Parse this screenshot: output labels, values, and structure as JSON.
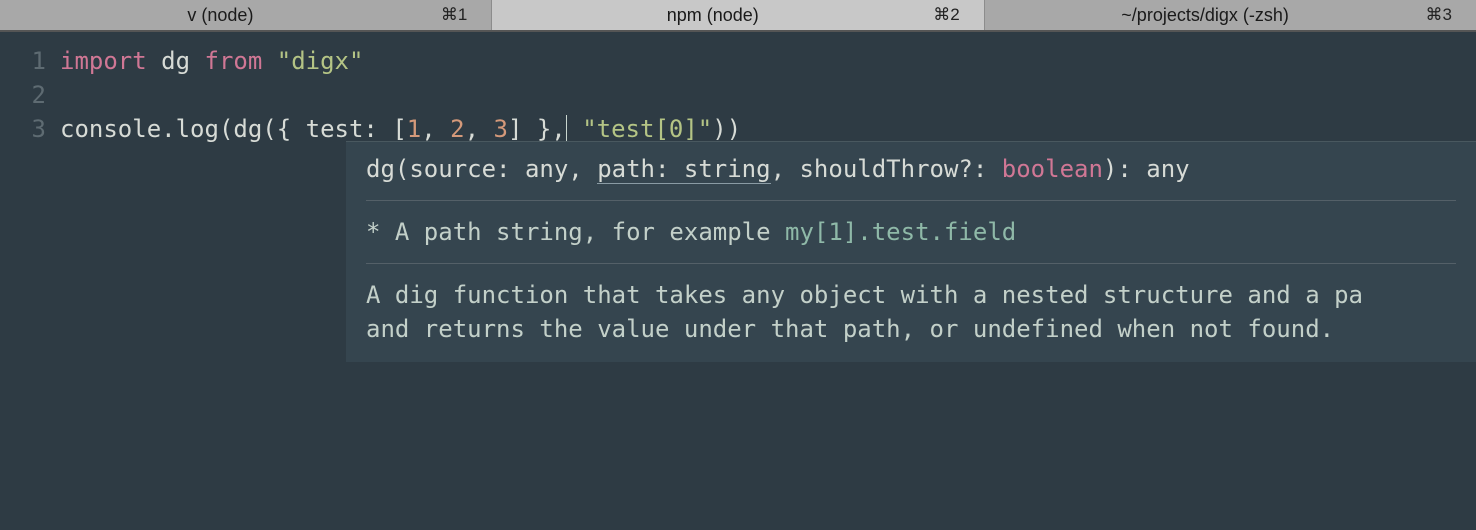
{
  "tabs": [
    {
      "title": "v (node)",
      "shortcut": "⌘1",
      "active": false
    },
    {
      "title": "npm (node)",
      "shortcut": "⌘2",
      "active": true
    },
    {
      "title": "~/projects/digx (-zsh)",
      "shortcut": "⌘3",
      "active": false
    }
  ],
  "gutter": {
    "l1": "1",
    "l2": "2",
    "l3": "3"
  },
  "code": {
    "l1": {
      "kw": "import",
      "mid": " dg ",
      "kw2": "from",
      "sp": " ",
      "str": "\"digx\""
    },
    "l3": {
      "pre": "console.log(dg({ test: [",
      "n1": "1",
      "c1": ", ",
      "n2": "2",
      "c2": ", ",
      "n3": "3",
      "post1": "] },",
      "sp": " ",
      "arg2": "\"test[0]\"",
      "post2": "))"
    }
  },
  "tooltip": {
    "sig": {
      "p0": "dg(source: any, ",
      "active": "path: string",
      "p1": ", shouldThrow?: ",
      "type": "boolean",
      "p2": "): any"
    },
    "bullet": " * A path string, for example ",
    "example": "my[1].test.field",
    "doc": "A dig function that takes any object with a nested structure and a pa\nand returns the value under that path, or undefined when not found."
  }
}
